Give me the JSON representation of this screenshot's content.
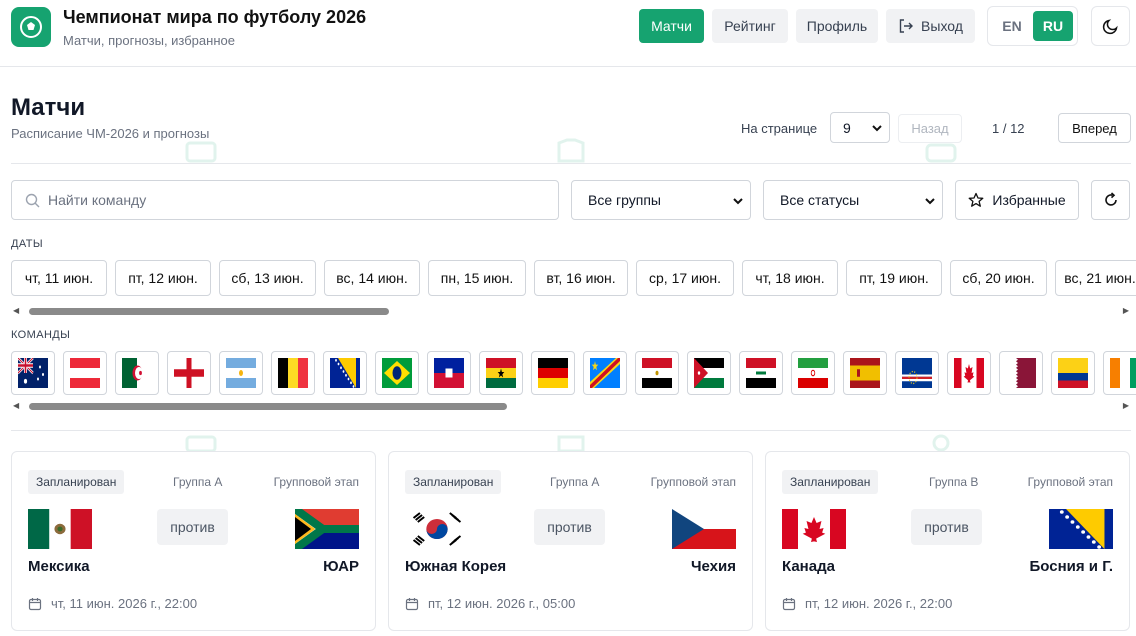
{
  "header": {
    "title": "Чемпионат мира по футболу 2026",
    "subtitle": "Матчи, прогнозы, избранное",
    "nav": {
      "matches": "Матчи",
      "rating": "Рейтинг",
      "profile": "Профиль",
      "logout": "Выход"
    },
    "lang": {
      "en": "EN",
      "ru": "RU",
      "active": "RU"
    }
  },
  "page": {
    "title": "Матчи",
    "subtitle": "Расписание ЧМ-2026 и прогнозы"
  },
  "pagination": {
    "per_page_label": "На странице",
    "per_page_value": "9",
    "prev": "Назад",
    "indicator": "1 / 12",
    "next": "Вперед"
  },
  "filters": {
    "search_placeholder": "Найти команду",
    "group_select": "Все группы",
    "status_select": "Все статусы",
    "favorites": "Избранные"
  },
  "dates": {
    "label": "ДАТЫ",
    "items": [
      "чт, 11 июн.",
      "пт, 12 июн.",
      "сб, 13 июн.",
      "вс, 14 июн.",
      "пн, 15 июн.",
      "вт, 16 июн.",
      "ср, 17 июн.",
      "чт, 18 июн.",
      "пт, 19 июн.",
      "сб, 20 июн.",
      "вс, 21 июн."
    ]
  },
  "teams": {
    "label": "КОМАНДЫ",
    "flags": [
      "australia",
      "austria",
      "algeria",
      "england",
      "argentina",
      "belgium",
      "bosnia",
      "brazil",
      "haiti",
      "ghana",
      "germany",
      "dr-congo",
      "egypt",
      "jordan",
      "iraq",
      "iran",
      "spain",
      "cape-verde",
      "canada",
      "qatar",
      "colombia",
      "ivory-coast"
    ]
  },
  "matches": [
    {
      "status": "Запланирован",
      "group": "Группа A",
      "stage": "Групповой этап",
      "home": "Мексика",
      "away": "ЮАР",
      "home_flag": "mexico",
      "away_flag": "south-africa",
      "vs": "против",
      "datetime": "чт, 11 июн. 2026 г., 22:00"
    },
    {
      "status": "Запланирован",
      "group": "Группа A",
      "stage": "Групповой этап",
      "home": "Южная Корея",
      "away": "Чехия",
      "home_flag": "south-korea",
      "away_flag": "czechia",
      "vs": "против",
      "datetime": "пт, 12 июн. 2026 г., 05:00"
    },
    {
      "status": "Запланирован",
      "group": "Группа B",
      "stage": "Групповой этап",
      "home": "Канада",
      "away": "Босния и Г.",
      "home_flag": "canada",
      "away_flag": "bosnia",
      "vs": "против",
      "datetime": "пт, 12 июн. 2026 г., 22:00"
    }
  ],
  "colors": {
    "accent": "#16a370",
    "border": "#d1d5db",
    "muted": "#6b7280"
  }
}
